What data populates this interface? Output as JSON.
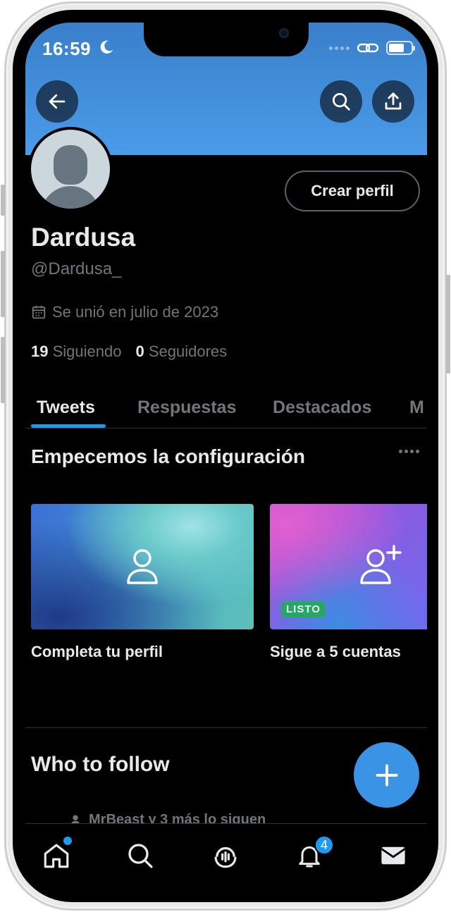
{
  "status_bar": {
    "time": "16:59"
  },
  "profile": {
    "display_name": "Dardusa",
    "handle": "@Dardusa_",
    "joined": "Se unió en julio de 2023",
    "following_count": "19",
    "following_label": "Siguiendo",
    "followers_count": "0",
    "followers_label": "Seguidores",
    "create_profile_label": "Crear perfil"
  },
  "tabs": [
    {
      "label": "Tweets",
      "active": true
    },
    {
      "label": "Respuestas",
      "active": false
    },
    {
      "label": "Destacados",
      "active": false
    },
    {
      "label": "M",
      "active": false
    }
  ],
  "setup": {
    "title": "Empecemos la configuración",
    "cards": [
      {
        "label": "Completa tu perfil",
        "icon": "person-icon"
      },
      {
        "label": "Sigue a 5 cuentas",
        "icon": "person-add-icon",
        "badge": "LISTO"
      }
    ]
  },
  "who_to_follow": {
    "title": "Who to follow",
    "social_context": "MrBeast y 3 más lo siguen"
  },
  "bottom_nav": {
    "items": [
      "home-icon",
      "search-icon",
      "spaces-icon",
      "bell-icon",
      "mail-icon"
    ],
    "notification_count": "4"
  },
  "colors": {
    "accent": "#1d9bf0",
    "banner": "#4a9be8",
    "background": "#000000",
    "badge_listo": "#27a668"
  }
}
